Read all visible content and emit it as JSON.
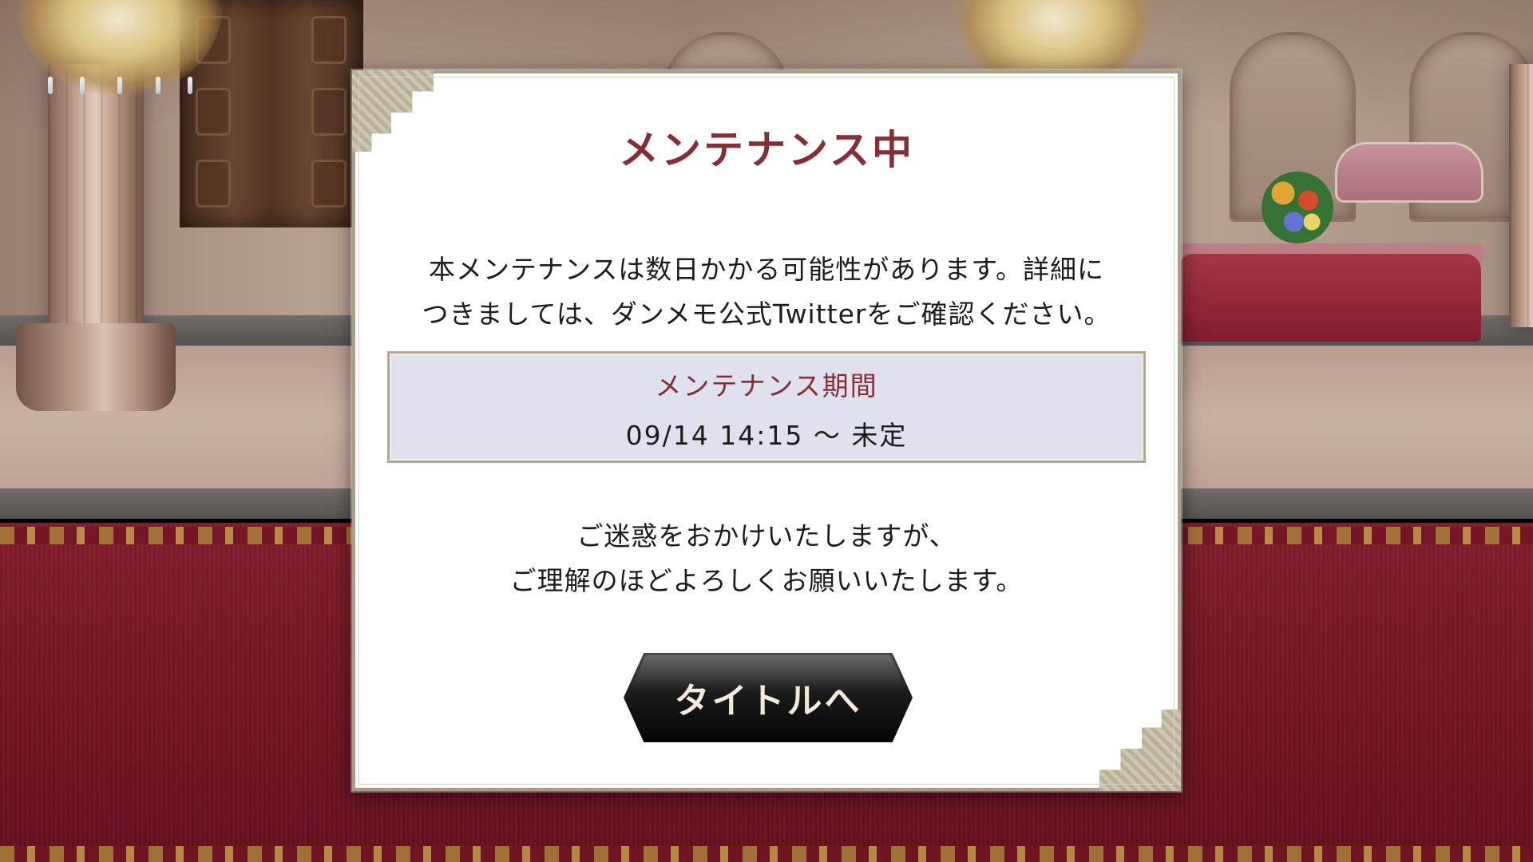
{
  "dialog": {
    "title": "メンテナンス中",
    "message_line1": "本メンテナンスは数日かかる可能性があります。詳細に",
    "message_line2": "つきましては、ダンメモ公式Twitterをご確認ください。",
    "period": {
      "label": "メンテナンス期間",
      "value": "09/14 14:15 〜 未定"
    },
    "apology_line1": "ご迷惑をおかけいたしますが、",
    "apology_line2": "ご理解のほどよろしくお願いいたします。",
    "button_label": "タイトルへ"
  },
  "colors": {
    "title": "#862d36",
    "period_box": "#dfe1ef",
    "border": "#a99f86",
    "button": "#111111"
  }
}
